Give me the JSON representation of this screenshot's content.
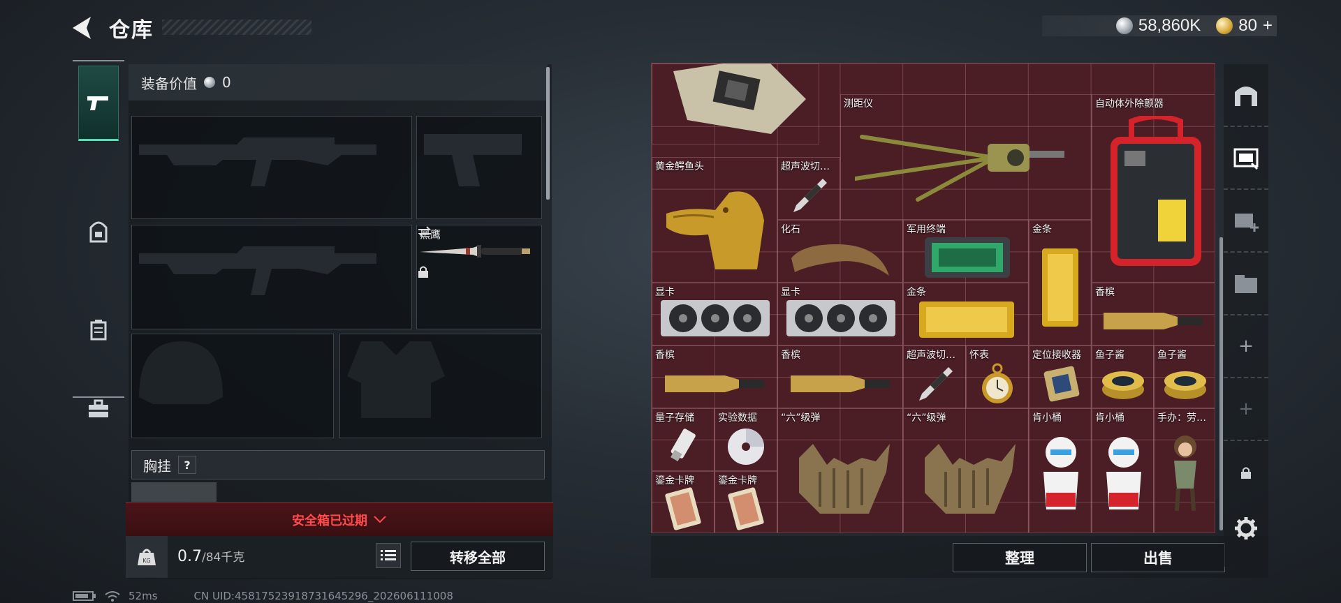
{
  "header": {
    "title": "仓库",
    "silver_amount": "58,860K",
    "gold_amount": "80",
    "gold_plus": "+"
  },
  "equipment": {
    "value_label": "装备价值",
    "value_amount": "0",
    "melee_name": "黑鹰",
    "vest_label": "胸挂",
    "vest_help": "?",
    "safebox_status": "安全箱已过期",
    "weight_current": "0.7",
    "weight_max": "/84千克",
    "transfer_all_label": "转移全部"
  },
  "stash": {
    "items": [
      {
        "name": "测距仪"
      },
      {
        "name": "自动体外除颤器"
      },
      {
        "name": "黄金鳄鱼头"
      },
      {
        "name": "超声波切…"
      },
      {
        "name": "化石"
      },
      {
        "name": "军用终端"
      },
      {
        "name": "金条"
      },
      {
        "name": "显卡"
      },
      {
        "name": "显卡"
      },
      {
        "name": "金条"
      },
      {
        "name": "香槟"
      },
      {
        "name": "香槟"
      },
      {
        "name": "香槟"
      },
      {
        "name": "超声波切…"
      },
      {
        "name": "怀表"
      },
      {
        "name": "定位接收器"
      },
      {
        "name": "鱼子酱"
      },
      {
        "name": "鱼子酱"
      },
      {
        "name": "量子存储"
      },
      {
        "name": "实验数据"
      },
      {
        "name": "“六”级弹"
      },
      {
        "name": "“六”级弹"
      },
      {
        "name": "肯小桶"
      },
      {
        "name": "肯小桶"
      },
      {
        "name": "手办：劳…"
      },
      {
        "name": "鎏金卡牌"
      },
      {
        "name": "鎏金卡牌"
      }
    ],
    "sort_label": "整理",
    "sell_label": "出售"
  },
  "right_nav": {
    "plus1": "+",
    "plus2": "+"
  },
  "status": {
    "ping": "52ms",
    "uid": "CN UID:458175239187316452​96_202606111008"
  },
  "colors": {
    "stash_bg": "#4b1e26",
    "accent_green": "#4fe0b4",
    "warning_red": "#ff4b4b"
  }
}
